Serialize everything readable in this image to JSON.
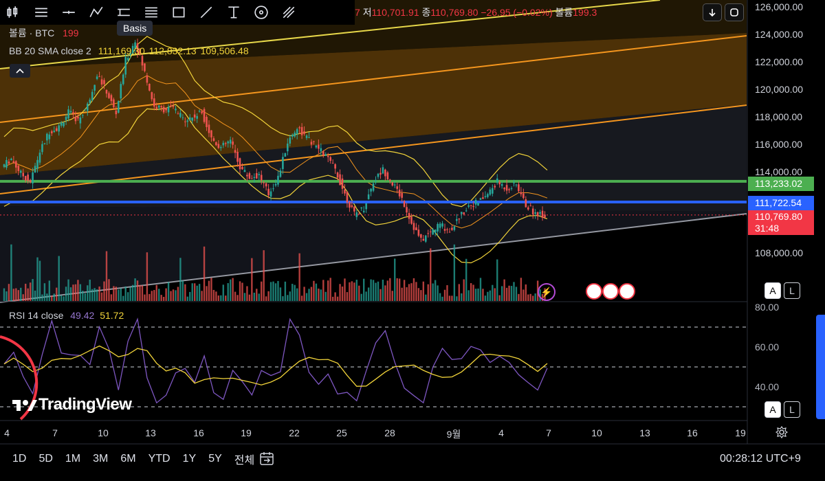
{
  "toolbar": {
    "tools": [
      {
        "name": "candles-icon",
        "interactable": true
      },
      {
        "name": "indicators-icon",
        "interactable": true
      },
      {
        "name": "horizontal-line-icon",
        "interactable": true
      },
      {
        "name": "pattern-icon",
        "interactable": true
      },
      {
        "name": "parallel-channel-icon",
        "interactable": true
      },
      {
        "name": "fib-icon",
        "interactable": true
      },
      {
        "name": "rectangle-icon",
        "interactable": true
      },
      {
        "name": "trend-line-icon",
        "interactable": true
      },
      {
        "name": "text-tool-icon",
        "interactable": true
      },
      {
        "name": "circle-target-icon",
        "interactable": true
      },
      {
        "name": "brush-icon",
        "interactable": true
      }
    ],
    "tooltip": "Basis"
  },
  "ohlc": {
    "prefix": "7",
    "low_label": "저",
    "low": "110,701.91",
    "close_label": "종",
    "close": "110,769.80",
    "change": "−26.95 (−0.02%)",
    "volume_label": "볼륨",
    "volume": "199.3"
  },
  "legend": {
    "volume_label": "볼륨 · BTC",
    "volume_value": "199",
    "bb_label": "BB 20 SMA close 2",
    "bb_basis": "111,169.30",
    "bb_upper": "112,832.13",
    "bb_lower": "109,506.48"
  },
  "rsi": {
    "label": "RSI 14 close",
    "value": "49.42",
    "ma": "51.72"
  },
  "price_axis": {
    "labels": [
      "126,000.00",
      "124,000.00",
      "122,000.00",
      "120,000.00",
      "118,000.00",
      "116,000.00",
      "114,000.00",
      "108,000.00"
    ]
  },
  "price_tags": {
    "green": "113,233.02",
    "blue": "111,722.54",
    "current": "110,769.80",
    "countdown": "31:48"
  },
  "rsi_axis": {
    "labels": [
      "80.00",
      "60.00",
      "40.00"
    ]
  },
  "time_axis": {
    "labels": [
      "4",
      "7",
      "10",
      "13",
      "16",
      "19",
      "22",
      "25",
      "28",
      "9월",
      "4",
      "7",
      "10",
      "13",
      "16",
      "19"
    ]
  },
  "ranges": [
    "1D",
    "5D",
    "1M",
    "3M",
    "6M",
    "YTD",
    "1Y",
    "5Y",
    "전체"
  ],
  "clock": "00:28:12 UTC+9",
  "brand": "TradingView",
  "colors": {
    "up": "#26a69a",
    "down": "#ef5350",
    "green_line": "#4caf50",
    "blue_line": "#2962ff",
    "bb": "#f2d43a",
    "rsi": "#7e57c2",
    "channel": "#f5961e",
    "current": "#f23645"
  },
  "chart_data": [
    {
      "type": "candlestick",
      "instrument": "BTC",
      "ylim": [
        106500,
        126500
      ],
      "x_ticks": [
        "4",
        "7",
        "10",
        "13",
        "16",
        "19",
        "22",
        "25",
        "28",
        "9월",
        "4",
        "7",
        "10",
        "13",
        "16",
        "19"
      ],
      "horizontal_levels": [
        113233.02,
        111722.54
      ],
      "last_price": 110769.8,
      "bollinger": {
        "basis": 111169.3,
        "upper": 112832.13,
        "lower": 109506.48
      },
      "close_path": [
        114300,
        114900,
        113800,
        113200,
        115400,
        116900,
        117200,
        118300,
        117700,
        118800,
        121100,
        119800,
        118200,
        122100,
        123500,
        121200,
        118700,
        118500,
        118600,
        117800,
        117900,
        118300,
        116400,
        115700,
        116200,
        114300,
        113500,
        113700,
        112300,
        113500,
        116100,
        117200,
        116400,
        115800,
        115100,
        114100,
        112300,
        110800,
        111300,
        113200,
        114100,
        113100,
        112000,
        110200,
        108900,
        109500,
        110100,
        109600,
        110600,
        111500,
        111700,
        112300,
        113200,
        112700,
        113000,
        111500,
        110900,
        110770
      ]
    },
    {
      "type": "line",
      "title": "RSI 14 close",
      "ylim": [
        30,
        80
      ],
      "series": [
        {
          "name": "RSI",
          "last": 49.42
        },
        {
          "name": "MA",
          "last": 51.72
        }
      ],
      "reference_levels": [
        70,
        50,
        30
      ]
    }
  ]
}
